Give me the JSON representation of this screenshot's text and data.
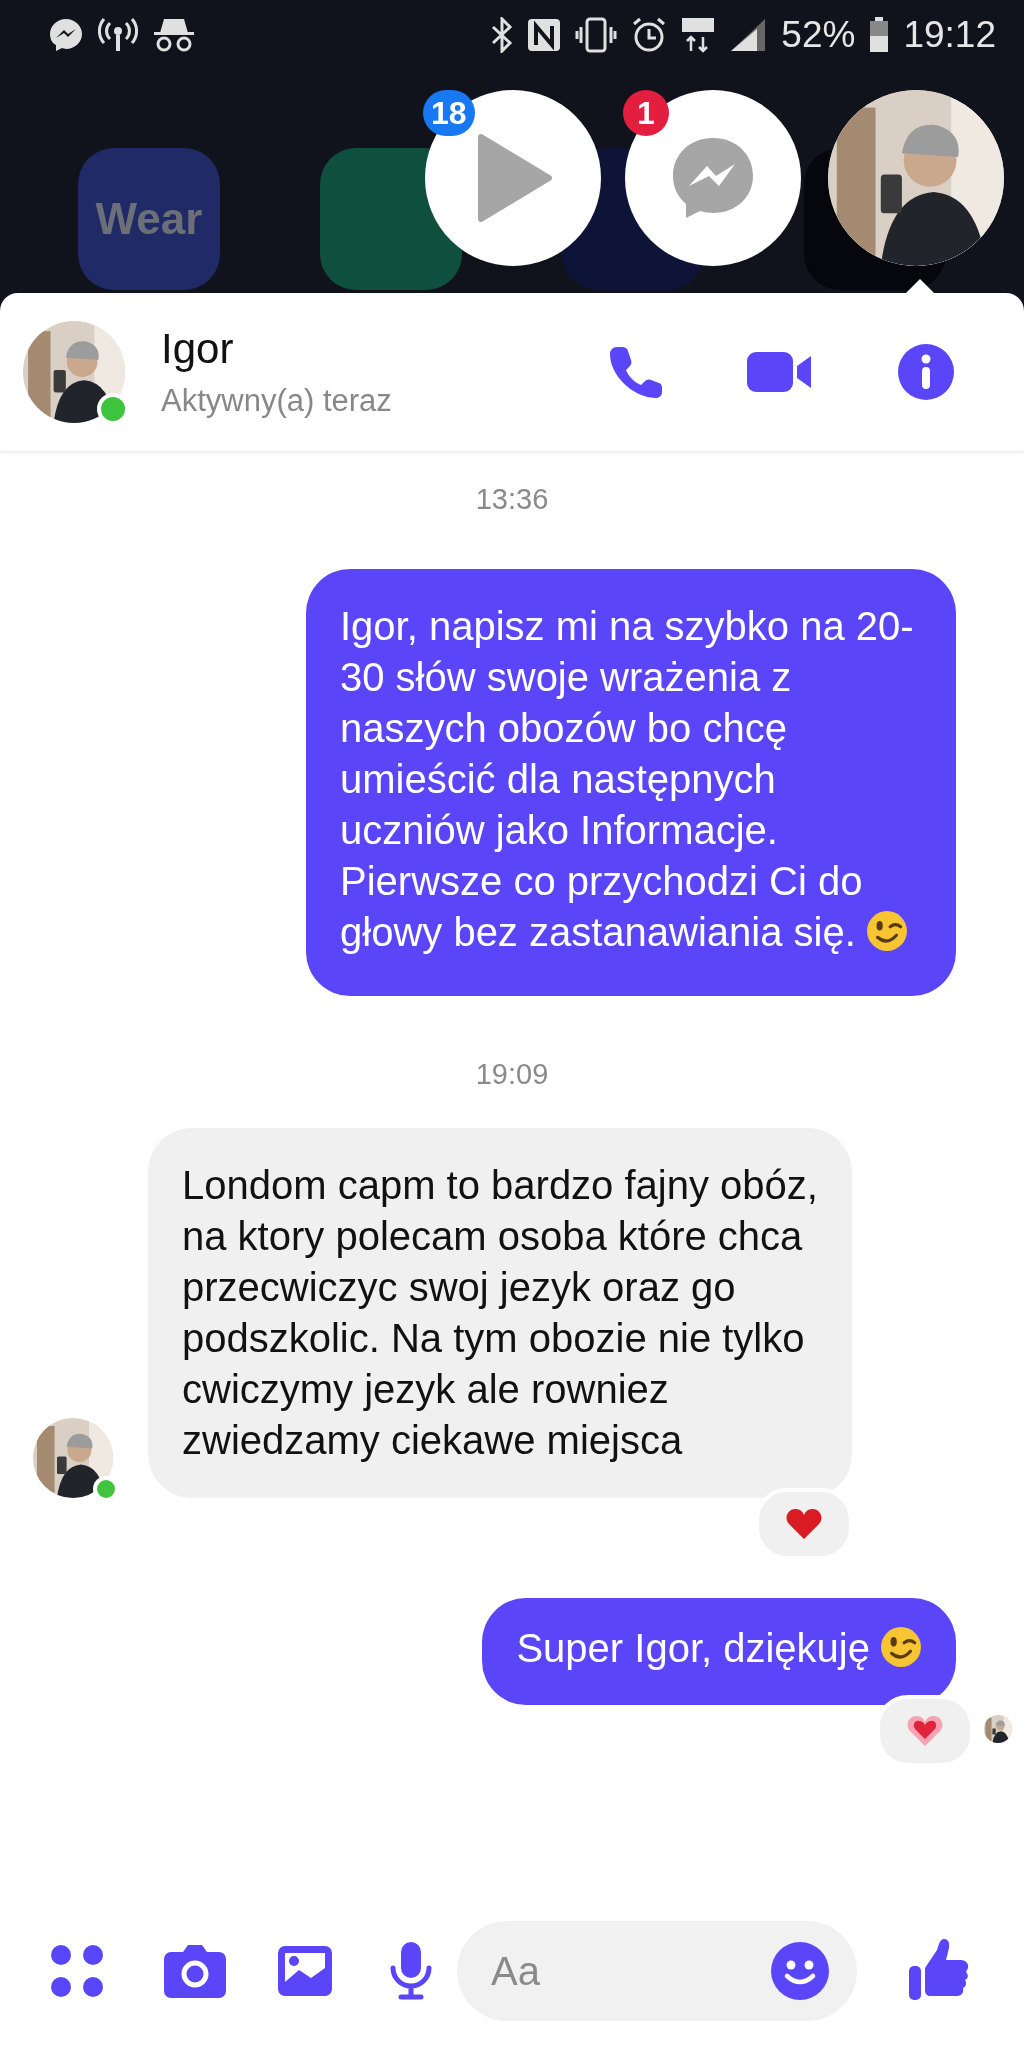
{
  "status_bar": {
    "battery": "52%",
    "time": "19:12"
  },
  "home_screen": {
    "app_label": "Wear"
  },
  "chat_heads": [
    {
      "kind": "video",
      "badge": "18",
      "color": "#1877f2"
    },
    {
      "kind": "messenger",
      "badge": "1",
      "color": "#e41e3f"
    },
    {
      "kind": "contact"
    }
  ],
  "header": {
    "name": "Igor",
    "status": "Aktywny(a) teraz",
    "online": true
  },
  "messages": [
    {
      "kind": "timestamp",
      "text": "13:36"
    },
    {
      "kind": "sent",
      "text": "Igor, napisz mi na szybko na 20-30 słów swoje wrażenia z naszych obozów bo chcę umieścić dla następnych uczniów jako Informacje. Pierwsze co przychodzi Ci do głowy bez zastanawiania się.",
      "wink": true,
      "reacted": false,
      "seen": false
    },
    {
      "kind": "timestamp",
      "text": "19:09"
    },
    {
      "kind": "received",
      "text": "Londom capm to bardzo fajny obóz, na ktory polecam osoba które chca przecwiczyc swoj jezyk oraz go podszkolic. Na tym obozie nie tylko cwiczymy jezyk ale rowniez zwiedzamy ciekawe miejsca",
      "wink": false,
      "reacted": true,
      "online": true
    },
    {
      "kind": "sent",
      "text": "Super Igor, dziękuję",
      "wink": true,
      "reacted": true,
      "seen": true
    }
  ],
  "composer": {
    "placeholder": "Aa"
  }
}
